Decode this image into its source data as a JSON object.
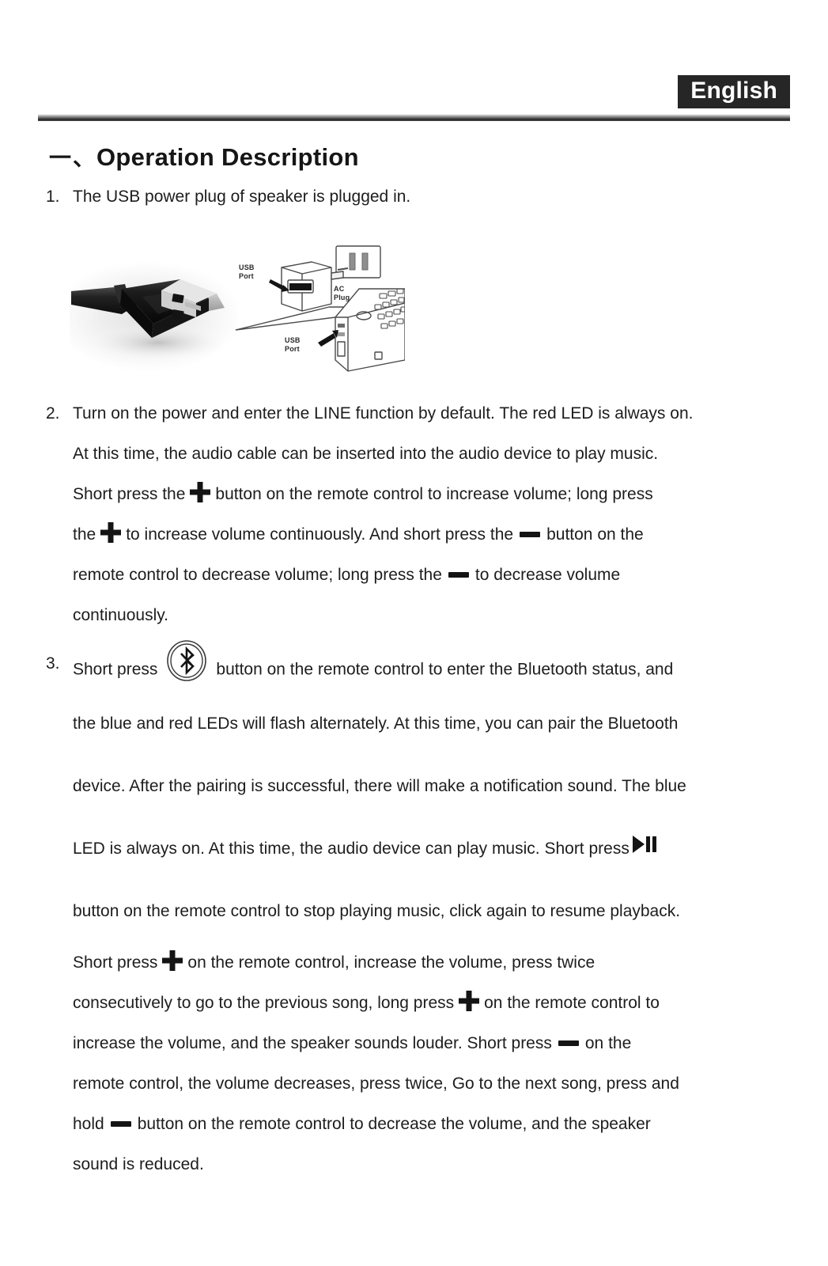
{
  "page": {
    "language_badge": "English",
    "heading_marker": "一、",
    "heading": "Operation Description"
  },
  "items": [
    {
      "number": "1.",
      "text": "The USB power plug of speaker is plugged in."
    },
    {
      "number": "2.",
      "line1": "Turn on the power and enter the LINE function by default. The red LED is always on.",
      "line2": "At this time, the audio cable can be inserted into the audio device to play music.",
      "line3_a": "Short press the",
      "line3_b": "button on the remote control to increase volume; long press",
      "line4_a": "the",
      "line4_b": "to increase volume continuously. And short press the",
      "line4_c": "button on the",
      "line5_a": "remote control to decrease volume; long press the",
      "line5_b": "to decrease volume",
      "line6": "continuously."
    },
    {
      "number": "3.",
      "line1_a": "Short press",
      "line1_b": "button on the remote control to enter the Bluetooth status, and",
      "line2": "the blue and red LEDs will flash alternately. At this time, you can pair the Bluetooth",
      "line3": "device. After the pairing is successful, there will make a notification sound. The blue",
      "line4_a": "LED is always on. At this time, the audio device can play music. Short press",
      "line5": "button on the remote control to stop playing music, click again to resume playback.",
      "line6_a": "Short press",
      "line6_b": "on the remote control, increase the volume, press twice",
      "line7_a": "consecutively to go to the previous song, long press",
      "line7_b": "on the remote control to",
      "line8_a": "increase the volume, and the speaker sounds louder. Short press",
      "line8_b": "on the",
      "line9": "remote control, the volume decreases, press twice, Go to the next song, press and",
      "line10_a": "hold",
      "line10_b": "button on the remote control to decrease the volume, and the speaker",
      "line11": "sound is reduced."
    }
  ],
  "figure": {
    "caption_labels": {
      "usb_port_top": "USB\nPort",
      "ac_plug": "AC\nPlug",
      "usb_port_bottom": "USB\nPort"
    },
    "usb_port_top_line1": "USB",
    "usb_port_top_line2": "Port",
    "ac_plug_line1": "AC",
    "ac_plug_line2": "Plug",
    "usb_port_bottom_line1": "USB",
    "usb_port_bottom_line2": "Port"
  },
  "icons": {
    "plus": "plus-button-icon",
    "minus": "minus-button-icon",
    "bluetooth": "bluetooth-button-icon",
    "play_pause": "play-pause-button-icon"
  },
  "colors": {
    "text": "#1d1d1d",
    "badge_bg": "#262626",
    "badge_text": "#ffffff",
    "rule_dark": "#262626",
    "icon": "#141414"
  }
}
